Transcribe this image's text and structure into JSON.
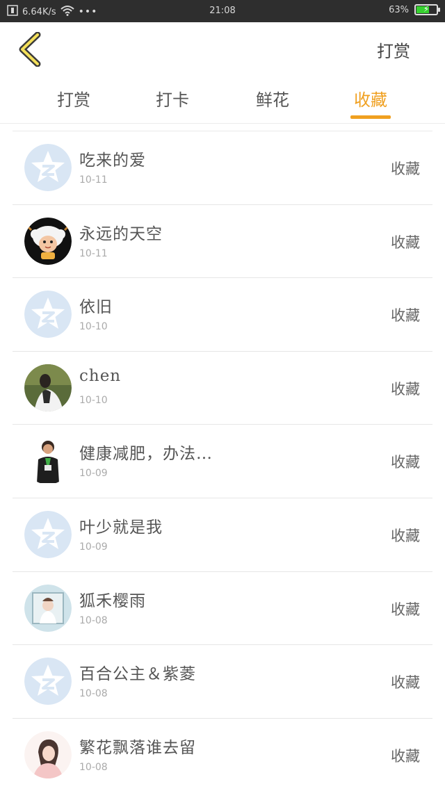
{
  "status_bar": {
    "speed": "6.64K/s",
    "dots": "•••",
    "time": "21:08",
    "battery": "63%",
    "battery_level": 0.63,
    "battery_color": "#36d12f"
  },
  "header": {
    "back_icon": "chevron-left-icon",
    "action_label": "打赏"
  },
  "tabs": [
    {
      "label": "打赏",
      "active": false
    },
    {
      "label": "打卡",
      "active": false
    },
    {
      "label": "鲜花",
      "active": false
    },
    {
      "label": "收藏",
      "active": true
    }
  ],
  "accent_color": "#f0a020",
  "list": [
    {
      "name": "吃来的爱",
      "date": "10-11",
      "action": "收藏",
      "avatar": "default-avatar-icon"
    },
    {
      "name": "永远的天空",
      "date": "10-11",
      "action": "收藏",
      "avatar": "cartoon-sheep-avatar"
    },
    {
      "name": "依旧",
      "date": "10-10",
      "action": "收藏",
      "avatar": "default-avatar-icon"
    },
    {
      "name": "chen",
      "date": "10-10",
      "action": "收藏",
      "avatar": "photo-avatar"
    },
    {
      "name": "健康减肥，办法…",
      "date": "10-09",
      "action": "收藏",
      "avatar": "photo-avatar"
    },
    {
      "name": "叶少就是我",
      "date": "10-09",
      "action": "收藏",
      "avatar": "default-avatar-icon"
    },
    {
      "name": "狐禾樱雨",
      "date": "10-08",
      "action": "收藏",
      "avatar": "photo-avatar"
    },
    {
      "name": "百合公主＆紫菱",
      "date": "10-08",
      "action": "收藏",
      "avatar": "default-avatar-icon"
    },
    {
      "name": "繁花飘落谁去留",
      "date": "10-08",
      "action": "收藏",
      "avatar": "photo-avatar"
    }
  ]
}
